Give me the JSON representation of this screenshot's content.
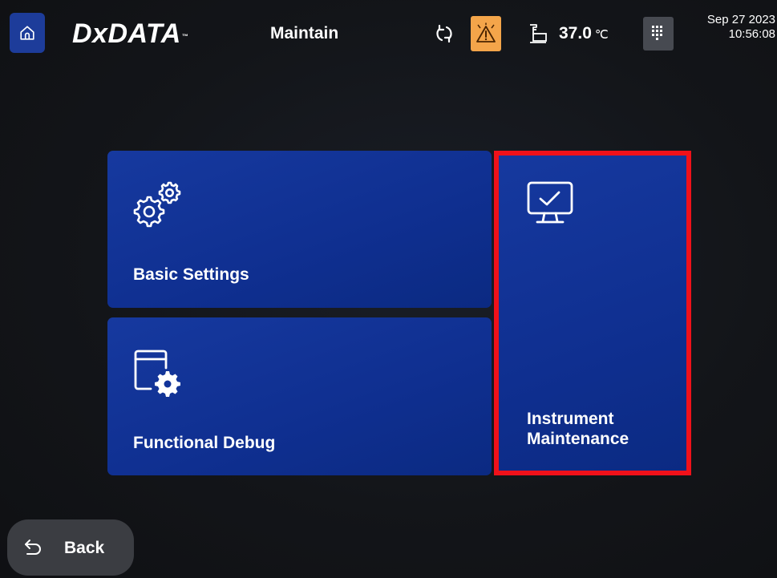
{
  "header": {
    "home_icon": "home-icon",
    "logo_text": "DxDATA",
    "logo_mark": "™",
    "title": "Maintain",
    "sync_icon": "sync-icon",
    "alarm_icon": "warning-icon",
    "thermometer_icon": "thermometer-icon",
    "temperature": "37.0",
    "temperature_unit": "℃",
    "keypad_icon": "keypad-icon",
    "date": "Sep 27 2023",
    "time": "10:56:08"
  },
  "tiles": [
    {
      "label": "Basic Settings",
      "icon": "gears-icon"
    },
    {
      "label": "Functional Debug",
      "icon": "window-gear-icon"
    },
    {
      "label": "Instrument Maintenance",
      "icon": "monitor-check-icon"
    }
  ],
  "footer": {
    "back_label": "Back",
    "back_icon": "back-arrow-icon"
  },
  "colors": {
    "tile_blue": "#12349a",
    "home_blue": "#1d3c9a",
    "alarm_orange": "#f4a54a",
    "highlight_red": "#f0111a",
    "background": "#131519"
  }
}
